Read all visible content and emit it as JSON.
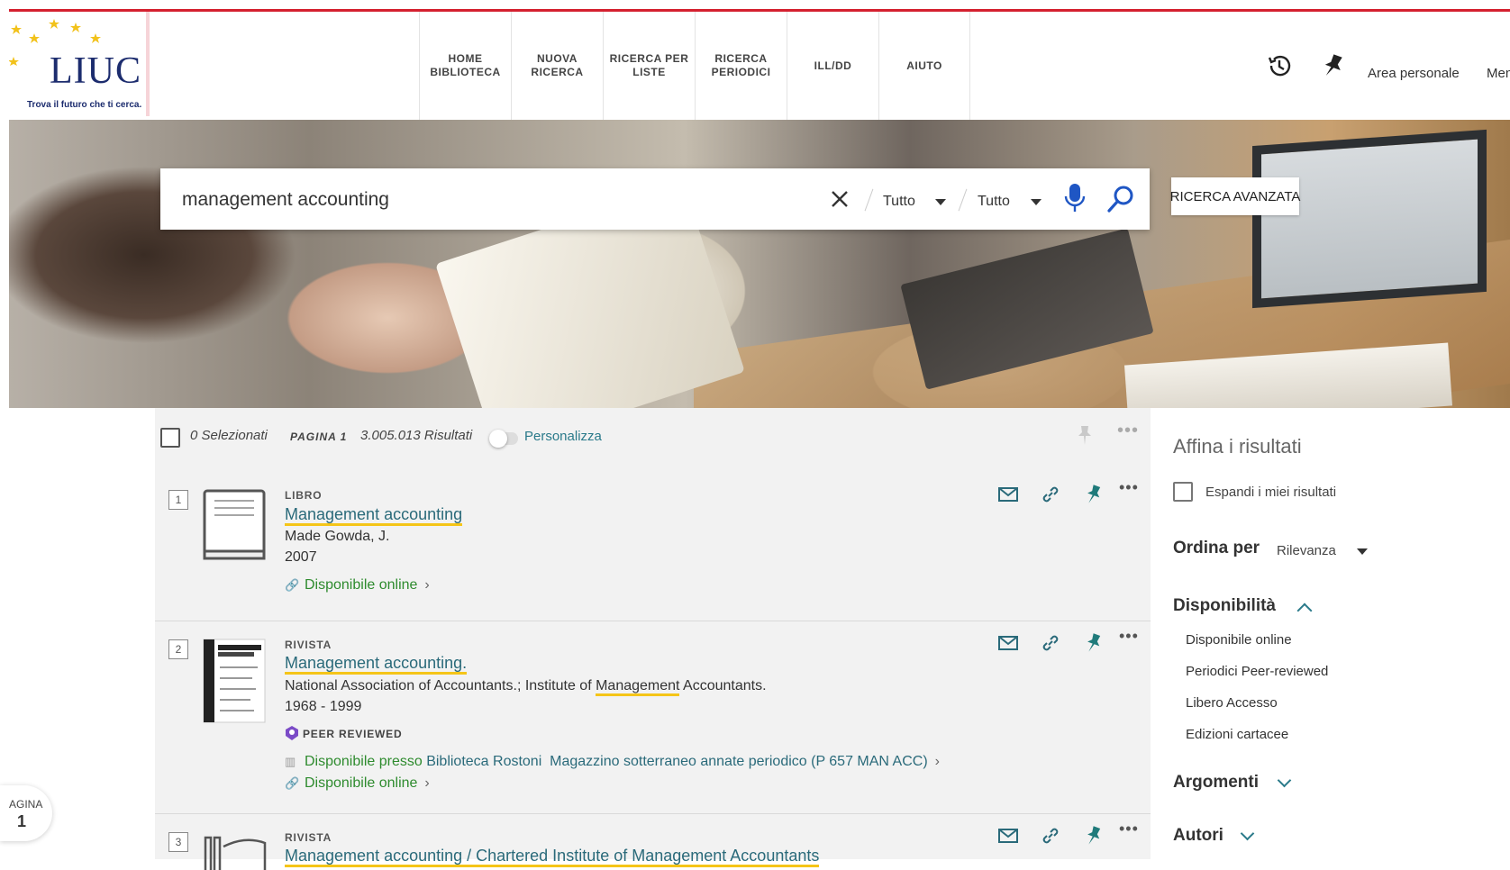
{
  "header": {
    "logo_text": "LIUC",
    "logo_tagline": "Trova il futuro che ti cerca.",
    "nav": [
      {
        "label": "HOME BIBLIOTECA"
      },
      {
        "label": "NUOVA RICERCA"
      },
      {
        "label": "RICERCA PER LISTE"
      },
      {
        "label": "RICERCA PERIODICI"
      },
      {
        "label": "ILL/DD"
      },
      {
        "label": "AIUTO"
      }
    ],
    "area_personale": "Area personale",
    "menu": "Menu"
  },
  "search": {
    "query": "management accounting",
    "scope1": "Tutto",
    "scope2": "Tutto",
    "advanced": "RICERCA AVANZATA"
  },
  "toolbar": {
    "selected": "0 Selezionati",
    "page": "PAGINA 1",
    "results": "3.005.013 Risultati",
    "personalize": "Personalizza"
  },
  "results": [
    {
      "num": "1",
      "type": "LIBRO",
      "title": "Management accounting",
      "author": "Made Gowda, J.",
      "date": "2007",
      "online": "Disponibile online"
    },
    {
      "num": "2",
      "type": "RIVISTA",
      "title": "Management accounting.",
      "author_pre": "National Association of Accountants.; Institute of ",
      "author_hl": "Management",
      "author_post": " Accountants.",
      "date": "1968 - 1999",
      "peer": "PEER REVIEWED",
      "avail_pre": "Disponibile presso ",
      "avail_lib": "Biblioteca Rostoni",
      "avail_loc": "Magazzino sotterraneo annate periodico (P 657 MAN ACC)",
      "online": "Disponibile online"
    },
    {
      "num": "3",
      "type": "RIVISTA",
      "title": "Management accounting / Chartered Institute of Management Accountants"
    }
  ],
  "sidebar": {
    "title": "Affina i risultati",
    "expand": "Espandi i miei risultati",
    "sort_label": "Ordina per",
    "sort_value": "Rilevanza",
    "availability": "Disponibilità",
    "availability_items": [
      "Disponibile online",
      "Periodici Peer-reviewed",
      "Libero Accesso",
      "Edizioni cartacee"
    ],
    "topics": "Argomenti",
    "authors": "Autori"
  },
  "page_indicator": {
    "label": "AGINA",
    "num": "1"
  },
  "colors": {
    "accent": "#2a7a8a",
    "brand_red": "#d4202f",
    "available": "#2e8b2e",
    "highlight": "#f5c518"
  }
}
